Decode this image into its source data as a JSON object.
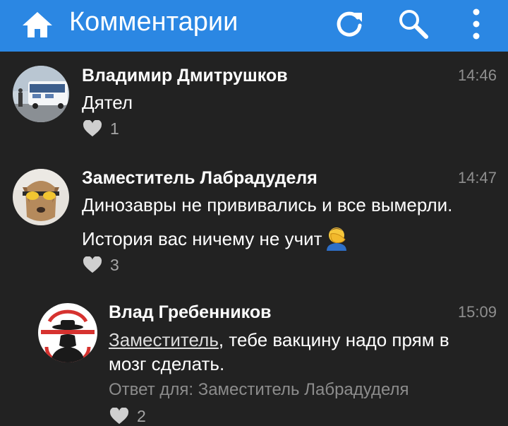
{
  "header": {
    "title": "Комментарии",
    "home_icon": "home-icon",
    "refresh_icon": "refresh-icon",
    "search_icon": "search-icon",
    "more_icon": "more-vertical-icon",
    "bar_color": "#2b87e3"
  },
  "comments": [
    {
      "author": "Владимир Дмитрушков",
      "time": "14:46",
      "text": "Дятел",
      "likes": "1"
    },
    {
      "author": "Заместитель Лабрадуделя",
      "time": "14:47",
      "text_line1": "Динозавры не прививались и все вымерли.",
      "text_line2": "История вас ничему не учит",
      "emoji": "facepalm-emoji",
      "likes": "3"
    },
    {
      "author": "Влад Гребенников",
      "time": "15:09",
      "mention": "Заместитель",
      "text_line1_rest": ", тебе вакцину надо прям в",
      "text_line2": "мозг сделать.",
      "reply_to": "Ответ для: Заместитель Лабрадуделя",
      "likes": "2"
    }
  ]
}
